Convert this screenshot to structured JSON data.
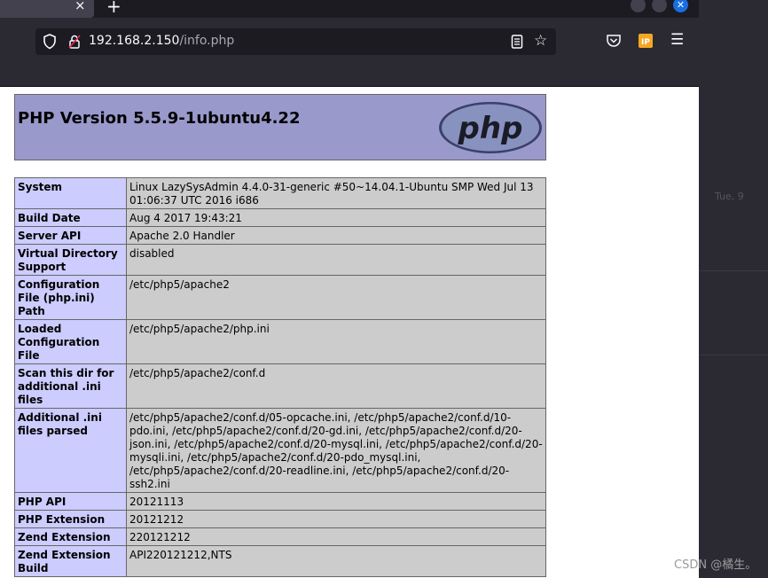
{
  "browser": {
    "url_host": "192.168.2.150",
    "url_path": "/info.php",
    "tab_close_glyph": "×",
    "new_tab_glyph": "+"
  },
  "page": {
    "title": "PHP Version 5.5.9-1ubuntu4.22",
    "logo_text": "php",
    "rows": [
      {
        "key": "System",
        "value": "Linux LazySysAdmin 4.4.0-31-generic #50~14.04.1-Ubuntu SMP Wed Jul 13 01:06:37 UTC 2016 i686"
      },
      {
        "key": "Build Date",
        "value": "Aug 4 2017 19:43:21"
      },
      {
        "key": "Server API",
        "value": "Apache 2.0 Handler"
      },
      {
        "key": "Virtual Directory Support",
        "value": "disabled"
      },
      {
        "key": "Configuration File (php.ini) Path",
        "value": "/etc/php5/apache2"
      },
      {
        "key": "Loaded Configuration File",
        "value": "/etc/php5/apache2/php.ini"
      },
      {
        "key": "Scan this dir for additional .ini files",
        "value": "/etc/php5/apache2/conf.d"
      },
      {
        "key": "Additional .ini files parsed",
        "value": "/etc/php5/apache2/conf.d/05-opcache.ini, /etc/php5/apache2/conf.d/10-pdo.ini, /etc/php5/apache2/conf.d/20-gd.ini, /etc/php5/apache2/conf.d/20-json.ini, /etc/php5/apache2/conf.d/20-mysql.ini, /etc/php5/apache2/conf.d/20-mysqli.ini, /etc/php5/apache2/conf.d/20-pdo_mysql.ini, /etc/php5/apache2/conf.d/20-readline.ini, /etc/php5/apache2/conf.d/20-ssh2.ini"
      },
      {
        "key": "PHP API",
        "value": "20121113"
      },
      {
        "key": "PHP Extension",
        "value": "20121212"
      },
      {
        "key": "Zend Extension",
        "value": "220121212"
      },
      {
        "key": "Zend Extension Build",
        "value": "API220121212,NTS"
      }
    ]
  },
  "side_panel": {
    "faint_text": "Tue, 9"
  },
  "watermark": "CSDN @橘生。",
  "colors": {
    "php_header": "#9999cc",
    "key_cell": "#ccccff",
    "value_cell": "#cccccc",
    "browser_chrome": "#2b2a33",
    "window_close": "#1a6ee0"
  }
}
